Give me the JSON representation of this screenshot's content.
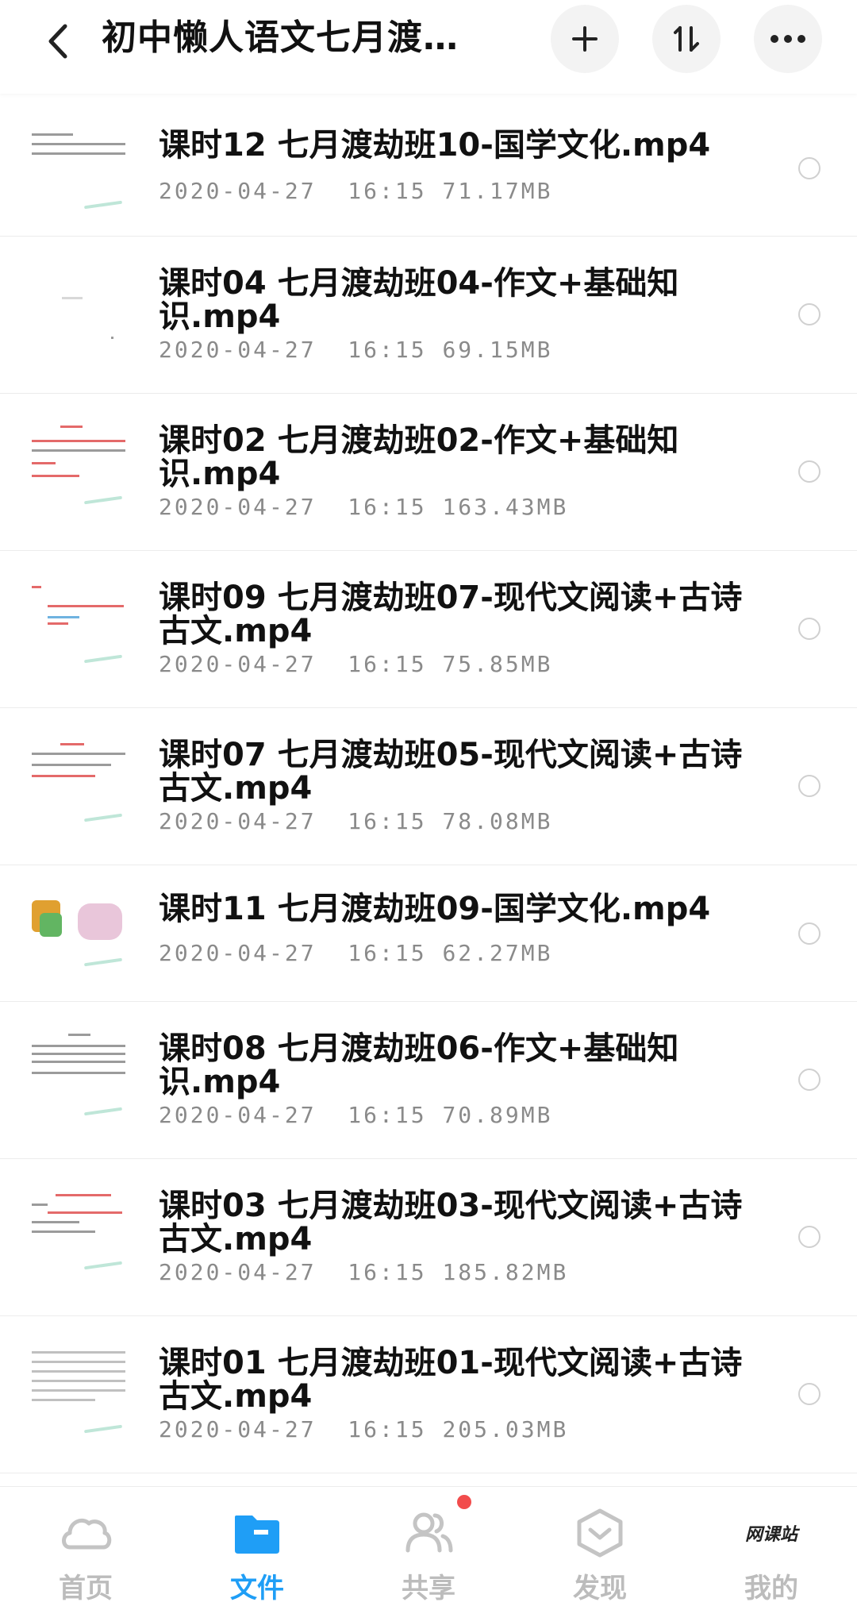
{
  "header": {
    "title": "初中懒人语文七月渡…",
    "icons": [
      "back-arrow",
      "plus",
      "sort",
      "more"
    ]
  },
  "files": [
    {
      "name": "课时12  七月渡劫班10-国学文化.mp4",
      "date": "2020-04-27",
      "time": "16:15",
      "size": "71.17MB"
    },
    {
      "name": "课时04  七月渡劫班04-作文+基础知识.mp4",
      "date": "2020-04-27",
      "time": "16:15",
      "size": "69.15MB"
    },
    {
      "name": "课时02  七月渡劫班02-作文+基础知识.mp4",
      "date": "2020-04-27",
      "time": "16:15",
      "size": "163.43MB"
    },
    {
      "name": "课时09  七月渡劫班07-现代文阅读+古诗古文.mp4",
      "date": "2020-04-27",
      "time": "16:15",
      "size": "75.85MB"
    },
    {
      "name": "课时07  七月渡劫班05-现代文阅读+古诗古文.mp4",
      "date": "2020-04-27",
      "time": "16:15",
      "size": "78.08MB"
    },
    {
      "name": "课时11  七月渡劫班09-国学文化.mp4",
      "date": "2020-04-27",
      "time": "16:15",
      "size": "62.27MB"
    },
    {
      "name": "课时08  七月渡劫班06-作文+基础知识.mp4",
      "date": "2020-04-27",
      "time": "16:15",
      "size": "70.89MB"
    },
    {
      "name": "课时03  七月渡劫班03-现代文阅读+古诗古文.mp4",
      "date": "2020-04-27",
      "time": "16:15",
      "size": "185.82MB"
    },
    {
      "name": "课时01  七月渡劫班01-现代文阅读+古诗古文.mp4",
      "date": "2020-04-27",
      "time": "16:15",
      "size": "205.03MB"
    }
  ],
  "nav": {
    "items": [
      {
        "label": "首页",
        "icon": "cloud-icon"
      },
      {
        "label": "文件",
        "icon": "folder-icon"
      },
      {
        "label": "共享",
        "icon": "people-icon"
      },
      {
        "label": "发现",
        "icon": "discover-icon"
      },
      {
        "label": "我的",
        "icon": "avatar-logo"
      }
    ],
    "active_index": 1,
    "avatar_logo_text": "网课站"
  },
  "colors": {
    "accent": "#1f9ef6",
    "badge": "#f24c4c",
    "inactive": "#bcbcbc"
  }
}
